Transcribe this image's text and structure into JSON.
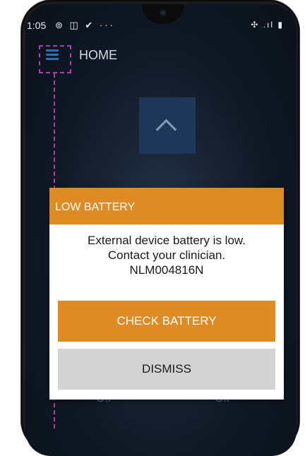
{
  "status_bar": {
    "time": "1:05",
    "left_icons": "⊚ ◫ ✔ ···",
    "right_icons": "✣ .ıl ▮"
  },
  "appbar": {
    "title": "HOME",
    "menu_icon": "hamburger-icon",
    "accent_color": "#2f6fb5"
  },
  "dialog": {
    "title": "LOW BATTERY",
    "message_line1": "External device battery is low.",
    "message_line2": "Contact your clinician.",
    "message_line3": "NLM004816N",
    "primary_label": "CHECK BATTERY",
    "secondary_label": "DISMISS",
    "header_color": "#df8b24"
  },
  "background": {
    "off_left": "Off",
    "off_right": "Off"
  }
}
